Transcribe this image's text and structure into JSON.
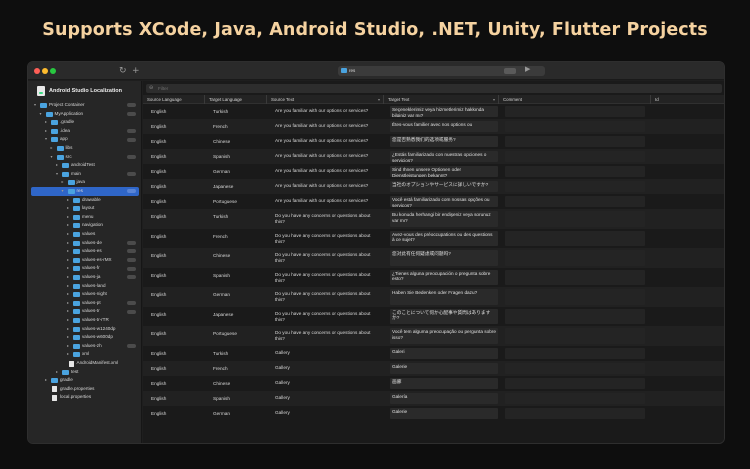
{
  "headline": "Supports XCode, Java, Android Studio, .NET, Unity, Flutter Projects",
  "titlebar": {
    "refresh_icon": "↻",
    "add_icon": "+",
    "path_value": "res",
    "play_icon": "▶"
  },
  "sidebar": {
    "project_title": "Android Studio Localization",
    "tree": [
      {
        "label": "Project Container",
        "depth": 0,
        "kind": "folder",
        "expanded": true,
        "badge": true
      },
      {
        "label": "MyApplication",
        "depth": 1,
        "kind": "folder",
        "expanded": true,
        "badge": true
      },
      {
        "label": ".gradle",
        "depth": 2,
        "kind": "folder",
        "expanded": false,
        "badge": false
      },
      {
        "label": ".idea",
        "depth": 2,
        "kind": "folder",
        "expanded": false,
        "badge": true
      },
      {
        "label": "app",
        "depth": 2,
        "kind": "folder",
        "expanded": true,
        "badge": true
      },
      {
        "label": "libs",
        "depth": 3,
        "kind": "folder",
        "expanded": false,
        "badge": false
      },
      {
        "label": "src",
        "depth": 3,
        "kind": "folder",
        "expanded": true,
        "badge": true
      },
      {
        "label": "androidTest",
        "depth": 4,
        "kind": "folder",
        "expanded": false,
        "badge": false
      },
      {
        "label": "main",
        "depth": 4,
        "kind": "folder",
        "expanded": true,
        "badge": true
      },
      {
        "label": "java",
        "depth": 5,
        "kind": "folder",
        "expanded": false,
        "badge": false
      },
      {
        "label": "res",
        "depth": 5,
        "kind": "folder",
        "expanded": true,
        "badge": true,
        "selected": true
      },
      {
        "label": "drawable",
        "depth": 6,
        "kind": "folder",
        "expanded": false,
        "badge": false
      },
      {
        "label": "layout",
        "depth": 6,
        "kind": "folder",
        "expanded": false,
        "badge": false
      },
      {
        "label": "menu",
        "depth": 6,
        "kind": "folder",
        "expanded": false,
        "badge": false
      },
      {
        "label": "navigation",
        "depth": 6,
        "kind": "folder",
        "expanded": false,
        "badge": false
      },
      {
        "label": "values",
        "depth": 6,
        "kind": "folder",
        "expanded": false,
        "badge": false
      },
      {
        "label": "values-de",
        "depth": 6,
        "kind": "folder",
        "expanded": false,
        "badge": true
      },
      {
        "label": "values-es",
        "depth": 6,
        "kind": "folder",
        "expanded": false,
        "badge": true
      },
      {
        "label": "values-es-rMX",
        "depth": 6,
        "kind": "folder",
        "expanded": false,
        "badge": true
      },
      {
        "label": "values-fr",
        "depth": 6,
        "kind": "folder",
        "expanded": false,
        "badge": true
      },
      {
        "label": "values-ja",
        "depth": 6,
        "kind": "folder",
        "expanded": false,
        "badge": true
      },
      {
        "label": "values-land",
        "depth": 6,
        "kind": "folder",
        "expanded": false,
        "badge": false
      },
      {
        "label": "values-night",
        "depth": 6,
        "kind": "folder",
        "expanded": false,
        "badge": false
      },
      {
        "label": "values-pt",
        "depth": 6,
        "kind": "folder",
        "expanded": false,
        "badge": true
      },
      {
        "label": "values-tr",
        "depth": 6,
        "kind": "folder",
        "expanded": false,
        "badge": true
      },
      {
        "label": "values-tr-rTR",
        "depth": 6,
        "kind": "folder",
        "expanded": false,
        "badge": false
      },
      {
        "label": "values-w1240dp",
        "depth": 6,
        "kind": "folder",
        "expanded": false,
        "badge": false
      },
      {
        "label": "values-w600dp",
        "depth": 6,
        "kind": "folder",
        "expanded": false,
        "badge": false
      },
      {
        "label": "values-zh",
        "depth": 6,
        "kind": "folder",
        "expanded": false,
        "badge": true
      },
      {
        "label": "xml",
        "depth": 6,
        "kind": "folder",
        "expanded": false,
        "badge": false
      },
      {
        "label": "AndroidManifest.xml",
        "depth": 5,
        "kind": "file",
        "expanded": false,
        "badge": false
      },
      {
        "label": "test",
        "depth": 4,
        "kind": "folder",
        "expanded": false,
        "badge": false
      },
      {
        "label": "gradle",
        "depth": 2,
        "kind": "folder",
        "expanded": false,
        "badge": false
      },
      {
        "label": "gradle.properties",
        "depth": 2,
        "kind": "file",
        "expanded": false,
        "badge": false
      },
      {
        "label": "local.properties",
        "depth": 2,
        "kind": "file",
        "expanded": false,
        "badge": false
      }
    ]
  },
  "filter": {
    "placeholder": "Filter",
    "icon": "⊖"
  },
  "table": {
    "columns": [
      "Source Language",
      "Target Language",
      "Source Text",
      "Target Text",
      "Comment",
      "Id"
    ],
    "rows": [
      [
        "English",
        "Turkish",
        "Are you familiar with our options or services?",
        "Seçeneklerimiz veya hizmetlerimiz hakkında bilginiz var mı?"
      ],
      [
        "English",
        "French",
        "Are you familiar with our options or services?",
        "Êtes-vous familier avec nos options ou"
      ],
      [
        "English",
        "Chinese",
        "Are you familiar with our options or services?",
        "您是否熟悉我们的选项或服务?"
      ],
      [
        "English",
        "Spanish",
        "Are you familiar with our options or services?",
        "¿Estás familiarizado con nuestras opciones o servicios?"
      ],
      [
        "English",
        "German",
        "Are you familiar with our options or services?",
        "Sind Ihnen unsere Optionen oder Dienstleistungen bekannt?"
      ],
      [
        "English",
        "Japanese",
        "Are you familiar with our options or services?",
        "当社のオプションやサービスに詳しいですか?"
      ],
      [
        "English",
        "Portuguese",
        "Are you familiar with our options or services?",
        "Você está familiarizado com nossas opções ou serviços?"
      ],
      [
        "English",
        "Turkish",
        "Do you have any concerns or questions about this?",
        "Bu konuda herhangi bir endişeniz veya sorunuz var mı?"
      ],
      [
        "English",
        "French",
        "Do you have any concerns or questions about this?",
        "Avez-vous des préoccupations ou des questions à ce sujet?"
      ],
      [
        "English",
        "Chinese",
        "Do you have any concerns or questions about this?",
        "您对此有任何疑虑或问题吗?"
      ],
      [
        "English",
        "Spanish",
        "Do you have any concerns or questions about this?",
        "¿Tienes alguna preocupación o pregunta sobre esto?"
      ],
      [
        "English",
        "German",
        "Do you have any concerns or questions about this?",
        "Haben Sie Bedenken oder Fragen dazu?"
      ],
      [
        "English",
        "Japanese",
        "Do you have any concerns or questions about this?",
        "このことについて何か心配事や質問はありますか?"
      ],
      [
        "English",
        "Portuguese",
        "Do you have any concerns or questions about this?",
        "Você tem alguma preocupação ou pergunta sobre isso?"
      ],
      [
        "English",
        "Turkish",
        "Gallery",
        "Galeri"
      ],
      [
        "English",
        "French",
        "Gallery",
        "Galerie"
      ],
      [
        "English",
        "Chinese",
        "Gallery",
        "画廊"
      ],
      [
        "English",
        "Spanish",
        "Gallery",
        "Galería"
      ],
      [
        "English",
        "German",
        "Gallery",
        "Galerie"
      ]
    ]
  },
  "colors": {
    "headline": "#f5d2a0",
    "accent": "#2f66c8",
    "folder": "#4aa3df"
  }
}
